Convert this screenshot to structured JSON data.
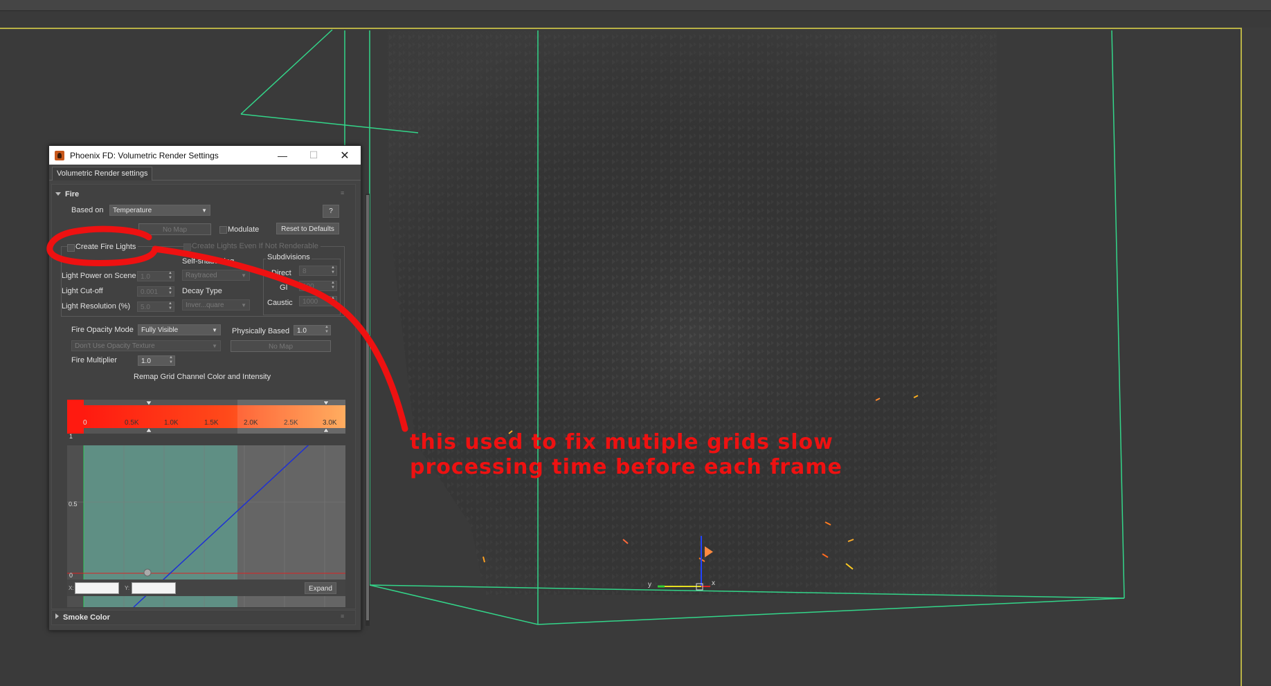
{
  "window": {
    "title": "Phoenix FD: Volumetric Render Settings",
    "minimize_glyph": "—",
    "maximize_glyph": "☐",
    "close_glyph": "✕"
  },
  "tabs": [
    "Volumetric Render settings"
  ],
  "fire": {
    "section_title": "Fire",
    "based_on_label": "Based on",
    "based_on_value": "Temperature",
    "help_label": "?",
    "no_map_label": "No Map",
    "modulate_label": "Modulate",
    "reset_label": "Reset to Defaults",
    "create_fire_lights_label": "Create Fire Lights",
    "create_lights_renderable_label": "Create Lights Even If Not Renderable",
    "self_shadowing_label": "Self-shadowing",
    "self_shadowing_value": "Raytraced",
    "subdivisions_label": "Subdivisions",
    "direct_label": "Direct",
    "direct_value": "8",
    "gi_label": "GI",
    "gi_value": "100",
    "caustic_label": "Caustic",
    "caustic_value": "1000",
    "light_power_label": "Light Power on Scene",
    "light_power_value": "1.0",
    "light_cutoff_label": "Light Cut-off",
    "light_cutoff_value": "0.001",
    "light_resolution_label": "Light Resolution (%)",
    "light_resolution_value": "5.0",
    "decay_type_label": "Decay Type",
    "decay_type_value": "Inver...quare",
    "fire_opacity_mode_label": "Fire Opacity Mode",
    "fire_opacity_mode_value": "Fully Visible",
    "physically_based_label": "Physically Based",
    "physically_based_value": "1.0",
    "opacity_texture_value": "Don't Use Opacity Texture",
    "opacity_no_map_label": "No Map",
    "fire_multiplier_label": "Fire Multiplier",
    "fire_multiplier_value": "1.0",
    "remap_title": "Remap Grid Channel Color and Intensity",
    "gradient_ticks": [
      "0",
      "0.5K",
      "1.0K",
      "1.5K",
      "2.0K",
      "2.5K",
      "3.0K"
    ],
    "curve_y_ticks": [
      "1",
      "0.5",
      "0"
    ],
    "x_field_label": "X:",
    "y_field_label": "Y:",
    "expand_label": "Expand"
  },
  "smoke_color": {
    "section_title": "Smoke Color"
  },
  "annotation": {
    "line1": "this used to fix mutiple grids slow",
    "line2": "processing time before each frame",
    "color": "#ee1111"
  },
  "colors": {
    "grid_wire": "#33d68a",
    "viewport_border": "#b9b246",
    "curve_line": "#1d2fd6",
    "gradient_start": "#ff1a10",
    "gradient_end": "#ffa24a"
  }
}
